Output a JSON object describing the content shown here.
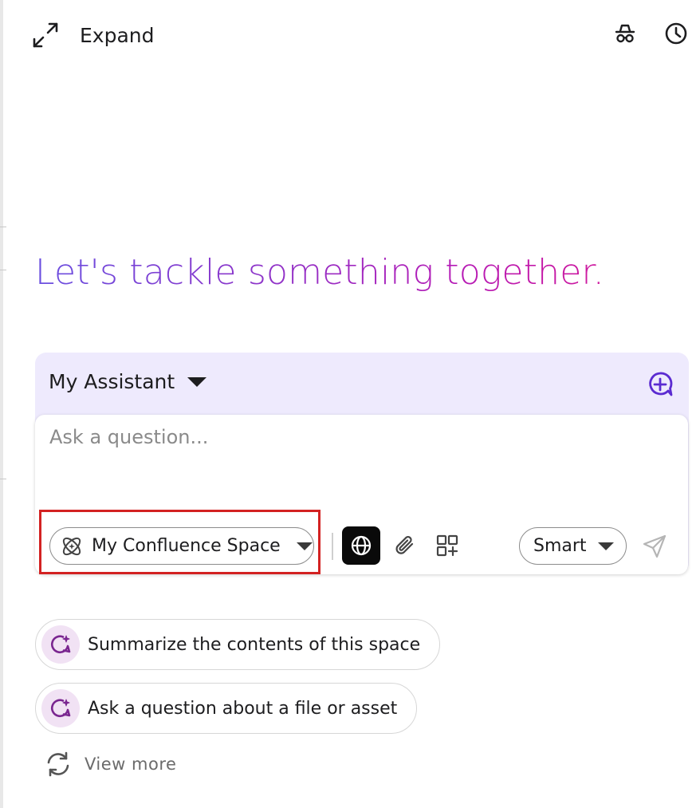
{
  "header": {
    "expand_label": "Expand",
    "expand_icon": "arrows-expand-icon",
    "incognito_icon": "incognito-icon",
    "history_icon": "clock-icon"
  },
  "headline": "Let's tackle something together.",
  "assistant": {
    "name": "My Assistant",
    "new_chat_icon": "new-chat-plus-icon"
  },
  "composer": {
    "value": "",
    "placeholder": "Ask a question...",
    "space_selector": {
      "label": "My Confluence Space",
      "icon": "confluence-space-icon",
      "highlighted": true
    },
    "tools": [
      {
        "name": "web-search",
        "icon": "globe-icon",
        "active": true
      },
      {
        "name": "attach",
        "icon": "paperclip-icon",
        "active": false
      },
      {
        "name": "add-app",
        "icon": "grid-plus-icon",
        "active": false
      }
    ],
    "mode": "Smart",
    "send_icon": "send-icon"
  },
  "suggestions": [
    {
      "label": "Summarize the contents of this space",
      "icon": "sparkle-chat-icon"
    },
    {
      "label": "Ask a question about a file or asset",
      "icon": "sparkle-chat-icon"
    }
  ],
  "view_more": {
    "label": "View more",
    "icon": "refresh-icon"
  },
  "colors": {
    "headline_gradient_start": "#6a4fe0",
    "headline_gradient_end": "#cf1a9e",
    "card_background": "#eeeafd",
    "accent_purple": "#5b2bd1",
    "highlight_red": "#d32222",
    "suggestion_icon_bg": "#f1e2f4"
  }
}
